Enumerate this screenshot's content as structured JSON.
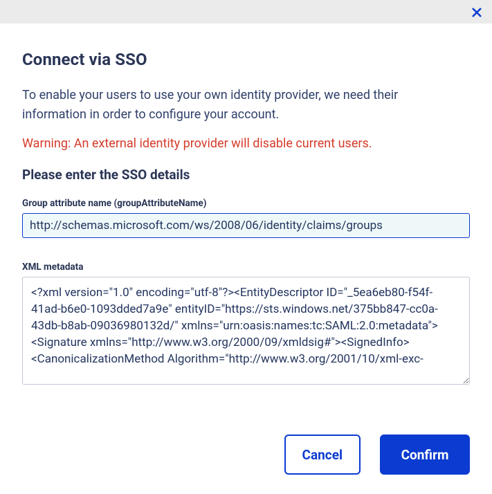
{
  "dialog": {
    "title": "Connect via SSO",
    "description": "To enable your users to use your own identity provider, we need their information in order to configure your account.",
    "warning": "Warning: An external identity provider will disable current users.",
    "subheading": "Please enter the SSO details"
  },
  "fields": {
    "groupAttrName": {
      "label": "Group attribute name (groupAttributeName)",
      "value": "http://schemas.microsoft.com/ws/2008/06/identity/claims/groups"
    },
    "xmlMetadata": {
      "label": "XML metadata",
      "value": "<?xml version=\"1.0\" encoding=\"utf-8\"?><EntityDescriptor ID=\"_5ea6eb80-f54f-41ad-b6e0-1093dded7a9e\" entityID=\"https://sts.windows.net/375bb847-cc0a-43db-b8ab-09036980132d/\" xmlns=\"urn:oasis:names:tc:SAML:2.0:metadata\"><Signature xmlns=\"http://www.w3.org/2000/09/xmldsig#\"><SignedInfo><CanonicalizationMethod Algorithm=\"http://www.w3.org/2001/10/xml-exc-"
    }
  },
  "buttons": {
    "cancel": "Cancel",
    "confirm": "Confirm"
  }
}
